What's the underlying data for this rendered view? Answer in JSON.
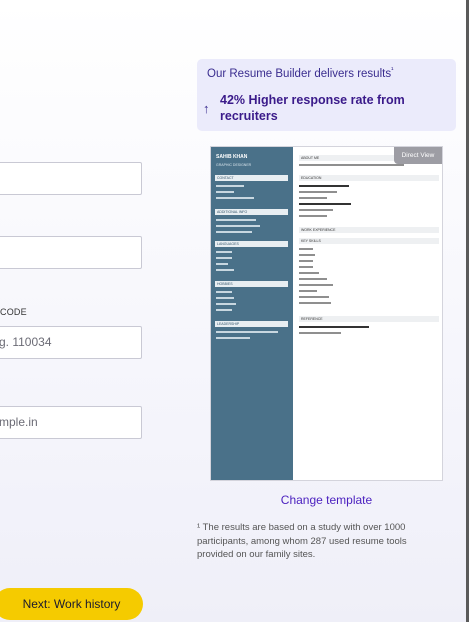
{
  "form": {
    "postcode_label": "CODE",
    "postcode_placeholder": "g. 110034",
    "email_placeholder": "mple.in",
    "next_button": "Next: Work history"
  },
  "promo": {
    "title": "Our Resume Builder delivers results",
    "title_marker": "¹",
    "arrow": "↑",
    "stat": "42% Higher response rate from recruiters"
  },
  "resume_preview": {
    "direct_view": "Direct View",
    "name": "SAHIB KHAN",
    "role": "GRAPHIC DESIGNER",
    "sidebar_sections": [
      "CONTACT",
      "ADDITIONAL INFO",
      "LANGUAGES",
      "HOBBIES",
      "LEADERSHIP"
    ],
    "main_sections": [
      "ABOUT ME",
      "EDUCATION",
      "WORK EXPERIENCE",
      "KEY SKILLS",
      "REFERENCE"
    ],
    "colors": {
      "sidebar": "#4a7189"
    }
  },
  "change_template": "Change template",
  "footnote": "¹ The results are based on a study with over 1000 participants, among whom 287 used resume tools provided on our family sites."
}
